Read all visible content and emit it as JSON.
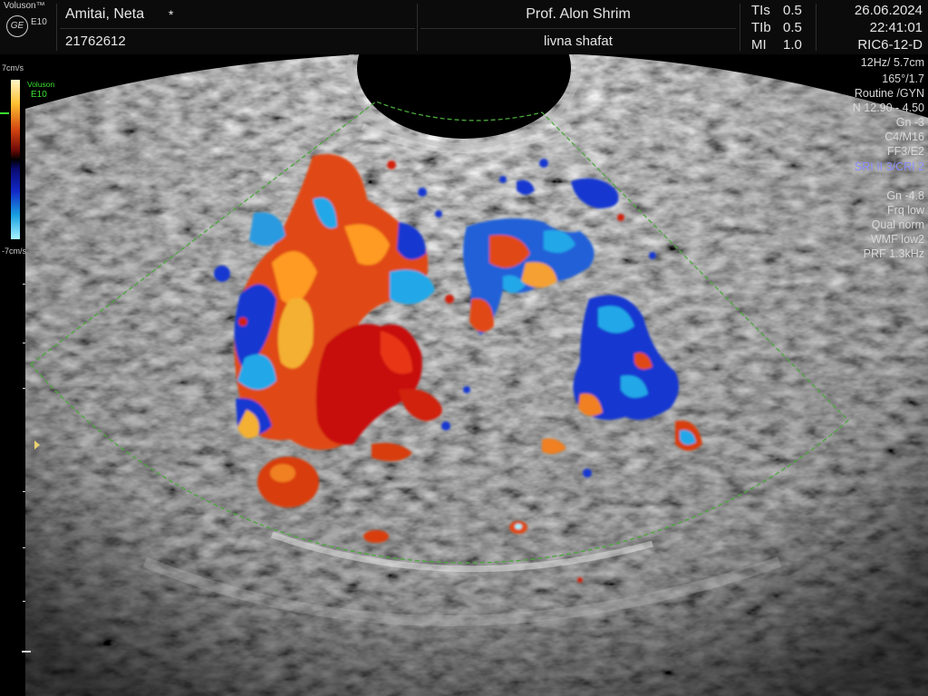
{
  "header": {
    "brand": "Voluson™",
    "logo": "GE",
    "model": "E10",
    "patient_name": "Amitai, Neta",
    "patient_flag": "*",
    "patient_id": "21762612",
    "physician": "Prof. Alon Shrim",
    "institution": "livna shafat",
    "indices": [
      {
        "label": "TIs",
        "value": "0.5"
      },
      {
        "label": "TIb",
        "value": "0.5"
      },
      {
        "label": "MI",
        "value": "1.0"
      }
    ],
    "date": "26.06.2024",
    "time": "22:41:01",
    "probe": "RIC6-12-D"
  },
  "params_top": [
    "12Hz/ 5.7cm",
    "165°/1.7",
    "Routine /GYN",
    "N 12.90 - 4.50",
    "Gn  -3",
    "C4/M16",
    "FF3/E2"
  ],
  "param_accent": "SRI II 3/CRI 2",
  "params_bottom": [
    "Gn -4.8",
    "Frq low",
    "Qual norm",
    "WMF low2",
    "PRF  1.3kHz"
  ],
  "scale": {
    "top": "7cm/s",
    "bottom": "-7cm/s",
    "brand": "Voluson",
    "model": "E10"
  },
  "colors": {
    "roi": "#4aa83a",
    "accent": "#8a8cff",
    "legend_green": "#39e030"
  }
}
